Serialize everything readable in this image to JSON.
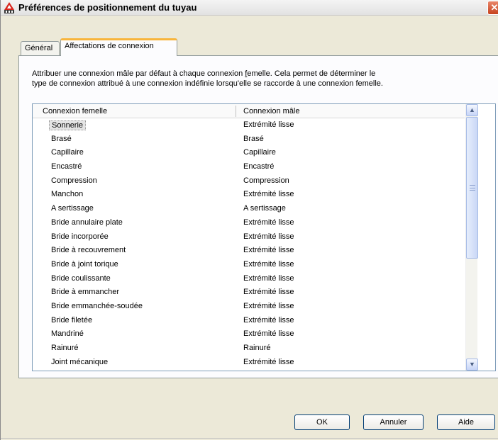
{
  "window": {
    "title": "Préférences de positionnement du tuyau",
    "icon": "mep-app-icon",
    "close_glyph": "✕"
  },
  "tabs": [
    {
      "label": "Général",
      "active": false
    },
    {
      "label": "Affectations de connexion",
      "active": true
    }
  ],
  "description": {
    "line1_a": "Attribuer une connexion mâle par défaut à chaque connexion ",
    "line1_ul": "f",
    "line1_b": "emelle. Cela permet de déterminer le",
    "line2": "type de connexion attribué à une connexion indéfinie lorsqu'elle se raccorde à une connexion femelle."
  },
  "listview": {
    "columns": [
      "Connexion femelle",
      "Connexion mâle"
    ],
    "selected_index": 0,
    "rows": [
      [
        "Sonnerie",
        "Extrémité lisse"
      ],
      [
        "Brasé",
        "Brasé"
      ],
      [
        "Capillaire",
        "Capillaire"
      ],
      [
        "Encastré",
        "Encastré"
      ],
      [
        "Compression",
        "Compression"
      ],
      [
        "Manchon",
        "Extrémité lisse"
      ],
      [
        "A sertissage",
        "A sertissage"
      ],
      [
        "Bride annulaire plate",
        "Extrémité lisse"
      ],
      [
        "Bride incorporée",
        "Extrémité lisse"
      ],
      [
        "Bride à recouvrement",
        "Extrémité lisse"
      ],
      [
        "Bride à joint torique",
        "Extrémité lisse"
      ],
      [
        "Bride coulissante",
        "Extrémité lisse"
      ],
      [
        "Bride à emmancher",
        "Extrémité lisse"
      ],
      [
        "Bride emmanchée-soudée",
        "Extrémité lisse"
      ],
      [
        "Bride filetée",
        "Extrémité lisse"
      ],
      [
        "Mandriné",
        "Extrémité lisse"
      ],
      [
        "Rainuré",
        "Rainuré"
      ],
      [
        "Joint mécanique",
        "Extrémité lisse"
      ]
    ]
  },
  "scrollbar": {
    "up_glyph": "▲",
    "down_glyph": "▼"
  },
  "buttons": {
    "ok": "OK",
    "cancel": "Annuler",
    "help": "Aide"
  },
  "colors": {
    "active_tab_accent": "#f8b53b",
    "close_button": "#c6421e",
    "dialog_background": "#ece9d8"
  }
}
